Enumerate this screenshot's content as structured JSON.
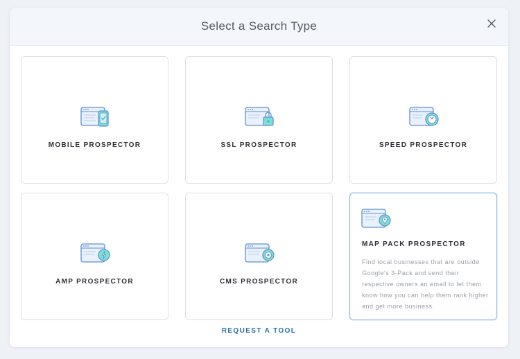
{
  "modal": {
    "title": "Select a Search Type",
    "close_icon": "close-icon"
  },
  "tools": [
    {
      "label": "MOBILE PROSPECTOR",
      "icon": "mobile-browser-icon",
      "selected": false
    },
    {
      "label": "SSL PROSPECTOR",
      "icon": "ssl-lock-browser-icon",
      "selected": false
    },
    {
      "label": "SPEED PROSPECTOR",
      "icon": "speed-gauge-browser-icon",
      "selected": false
    },
    {
      "label": "AMP PROSPECTOR",
      "icon": "amp-bolt-browser-icon",
      "selected": false
    },
    {
      "label": "CMS PROSPECTOR",
      "icon": "cms-gear-browser-icon",
      "selected": false
    },
    {
      "label": "MAP PACK PROSPECTOR",
      "icon": "map-pin-browser-icon",
      "selected": true,
      "description": "Find local businesses that are outside Google's 3-Pack and send their respective owners an email to let them know how you can help them rank higher and get more business."
    }
  ],
  "footer": {
    "request_tool_label": "REQUEST A TOOL"
  },
  "colors": {
    "accent": "#2e6bb0",
    "icon_stroke": "#5b8fd6",
    "icon_fill": "#e9f1fc",
    "badge_fill": "#7be0d0",
    "selected_border": "#8cb6e6",
    "modal_header_bg": "#f3f6fa"
  }
}
